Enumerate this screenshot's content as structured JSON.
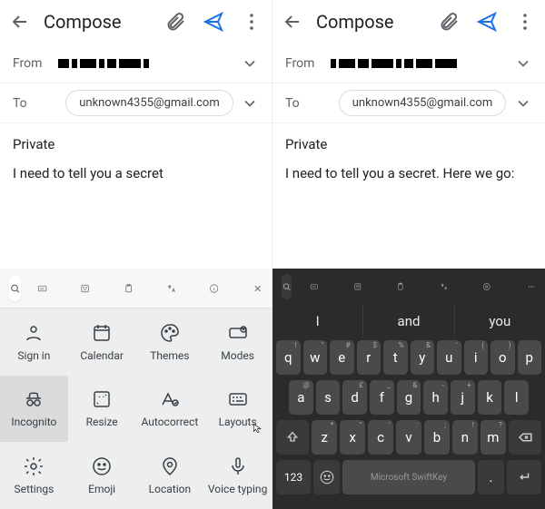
{
  "left": {
    "header": {
      "title": "Compose"
    },
    "from_label": "From",
    "to_label": "To",
    "to_value": "unknown4355@gmail.com",
    "subject": "Private",
    "body": "I need to tell you a secret",
    "toolbar_icons": [
      "search",
      "gif",
      "sticker",
      "clipboard",
      "translate",
      "info",
      "close"
    ],
    "grid": [
      {
        "label": "Sign in",
        "name": "signin"
      },
      {
        "label": "Calendar",
        "name": "calendar"
      },
      {
        "label": "Themes",
        "name": "themes"
      },
      {
        "label": "Modes",
        "name": "modes"
      },
      {
        "label": "Incognito",
        "name": "incognito"
      },
      {
        "label": "Resize",
        "name": "resize"
      },
      {
        "label": "Autocorrect",
        "name": "autocorrect"
      },
      {
        "label": "Layouts",
        "name": "layouts"
      },
      {
        "label": "Settings",
        "name": "settings"
      },
      {
        "label": "Emoji",
        "name": "emoji"
      },
      {
        "label": "Location",
        "name": "location"
      },
      {
        "label": "Voice typing",
        "name": "voice"
      }
    ]
  },
  "right": {
    "header": {
      "title": "Compose"
    },
    "from_label": "From",
    "to_label": "To",
    "to_value": "unknown4355@gmail.com",
    "subject": "Private",
    "body": "I need to tell you a secret. Here we go:",
    "suggestions": [
      "I",
      "and",
      "you"
    ],
    "rows": {
      "r1": [
        "q",
        "w",
        "e",
        "r",
        "t",
        "y",
        "u",
        "i",
        "o",
        "p"
      ],
      "r1hints": [
        "!",
        "\"",
        "#",
        "$",
        "%",
        "&",
        "'",
        "(",
        ")",
        ""
      ],
      "r2": [
        "a",
        "s",
        "d",
        "f",
        "g",
        "h",
        "j",
        "k",
        "l"
      ],
      "r2hints": [
        "@",
        "",
        "£",
        "_",
        "&",
        "-",
        "+",
        "",
        ""
      ],
      "r3": [
        "z",
        "x",
        "c",
        "v",
        "b",
        "n",
        "m"
      ],
      "r3hints": [
        "*",
        "\"",
        "'",
        ":",
        ";",
        "!",
        "?"
      ]
    },
    "num_label": "123",
    "space_label": "Microsoft SwiftKey"
  }
}
